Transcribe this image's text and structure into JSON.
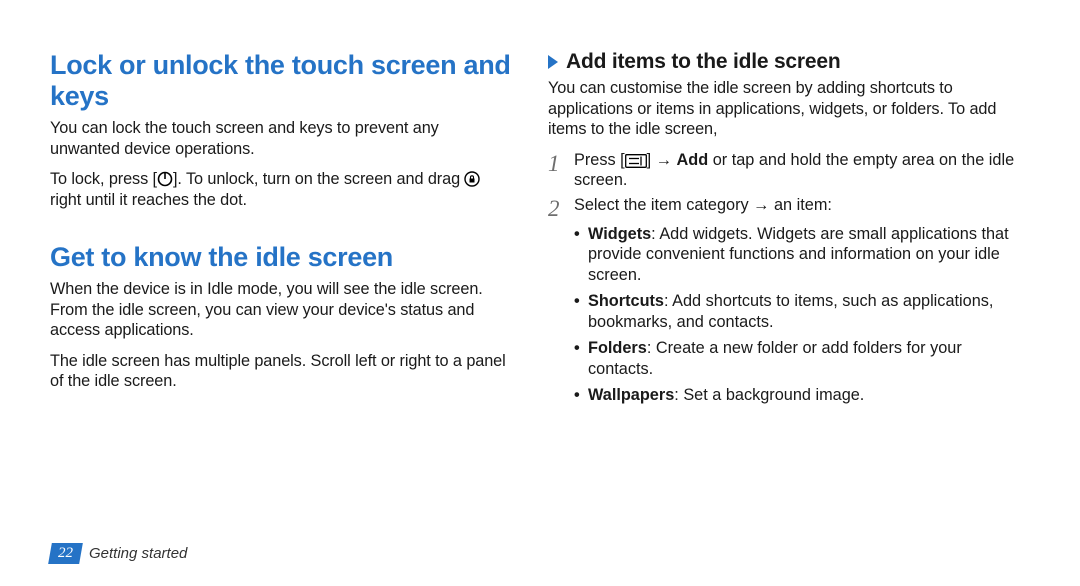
{
  "left": {
    "h2a": "Lock or unlock the touch screen and keys",
    "p1": "You can lock the touch screen and keys to prevent any unwanted device operations.",
    "p2a": "To lock, press [",
    "p2b": "]. To unlock, turn on the screen and drag ",
    "p2c": " right until it reaches the dot.",
    "h2b": "Get to know the idle screen",
    "p3": "When the device is in Idle mode, you will see the idle screen. From the idle screen, you can view your device's status and access applications.",
    "p4": "The idle screen has multiple panels. Scroll left or right to a panel of the idle screen."
  },
  "right": {
    "h3": "Add items to the idle screen",
    "intro": "You can customise the idle screen by adding shortcuts to applications or items in applications, widgets, or folders. To add items to the idle screen,",
    "step1_a": "Press [",
    "step1_b": "] → ",
    "step1_bold": "Add",
    "step1_c": " or tap and hold the empty area on the idle screen.",
    "step2": "Select the item category → an item:",
    "bullets": {
      "widgets_t": "Widgets",
      "widgets": ": Add widgets. Widgets are small applications that provide convenient functions and information on your idle screen.",
      "shortcuts_t": "Shortcuts",
      "shortcuts": ": Add shortcuts to items, such as applications, bookmarks, and contacts.",
      "folders_t": "Folders",
      "folders": ": Create a new folder or add folders for your contacts.",
      "wallpapers_t": "Wallpapers",
      "wallpapers": ": Set a background image."
    }
  },
  "footer": {
    "page": "22",
    "section": "Getting started"
  }
}
